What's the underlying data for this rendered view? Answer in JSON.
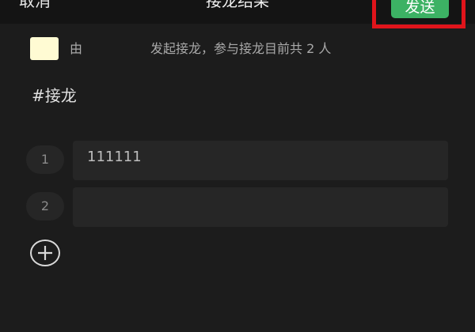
{
  "header": {
    "cancel_label": "取消",
    "title": "接龙结果",
    "send_label": "发送"
  },
  "info": {
    "prefix": "由",
    "suffix": "发起接龙，参与接龙目前共 2 人"
  },
  "hashtag": "#接龙",
  "entries": [
    {
      "number": "1",
      "value": "111111"
    },
    {
      "number": "2",
      "value": ""
    }
  ],
  "colors": {
    "background": "#1c1c1c",
    "send_button": "#3cb264",
    "highlight_border": "#e0141b",
    "avatar": "#fffbd3"
  },
  "icons": {
    "add": "plus-circle-icon"
  }
}
